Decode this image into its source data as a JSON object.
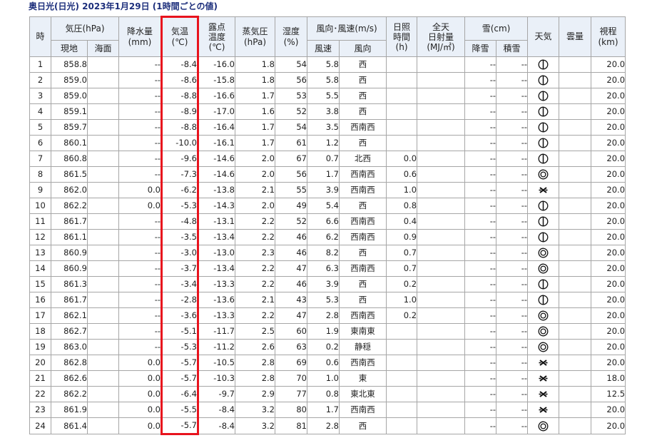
{
  "title": "奥日光(日光)  2023年1月29日  (1時間ごとの値)",
  "header": {
    "hour": "時",
    "pressure": "気圧(hPa)",
    "pressure_station": "現地",
    "pressure_sea": "海面",
    "precip": "降水量\n(mm)",
    "temp": "気温\n(℃)",
    "dew": "露点\n温度\n(℃)",
    "vapor": "蒸気圧\n(hPa)",
    "humidity": "湿度\n(%)",
    "wind": "風向･風速(m/s)",
    "wind_speed": "風速",
    "wind_dir": "風向",
    "sunshine": "日照\n時間\n(h)",
    "radiation": "全天\n日射量\n(MJ/㎡)",
    "snow": "雪(cm)",
    "snowfall": "降雪",
    "snowdepth": "積雪",
    "weather": "天気",
    "cloud": "雲量",
    "visibility": "視程\n(km)"
  },
  "highlight_color": "#e8131d",
  "weather_icon_names": {
    "clear-ish": "partly-cloudy-icon",
    "cloudy": "cloudy-icon",
    "snow": "snow-icon"
  },
  "rows": [
    {
      "hour": "1",
      "p": "858.8",
      "sea": "",
      "precip": "--",
      "temp": "-8.4",
      "dew": "-16.0",
      "vap": "1.8",
      "hum": "54",
      "ws": "5.8",
      "wd": "西",
      "sun": "",
      "rad": "",
      "snowfall": "--",
      "snowdepth": "--",
      "wx": "partly",
      "cloud": "",
      "vis": "20.0"
    },
    {
      "hour": "2",
      "p": "859.0",
      "sea": "",
      "precip": "--",
      "temp": "-8.6",
      "dew": "-15.8",
      "vap": "1.8",
      "hum": "56",
      "ws": "5.8",
      "wd": "西",
      "sun": "",
      "rad": "",
      "snowfall": "--",
      "snowdepth": "--",
      "wx": "partly",
      "cloud": "",
      "vis": "20.0"
    },
    {
      "hour": "3",
      "p": "859.0",
      "sea": "",
      "precip": "--",
      "temp": "-8.8",
      "dew": "-16.6",
      "vap": "1.7",
      "hum": "53",
      "ws": "5.5",
      "wd": "西",
      "sun": "",
      "rad": "",
      "snowfall": "--",
      "snowdepth": "--",
      "wx": "partly",
      "cloud": "",
      "vis": "20.0"
    },
    {
      "hour": "4",
      "p": "859.1",
      "sea": "",
      "precip": "--",
      "temp": "-8.9",
      "dew": "-17.0",
      "vap": "1.6",
      "hum": "52",
      "ws": "3.8",
      "wd": "西",
      "sun": "",
      "rad": "",
      "snowfall": "--",
      "snowdepth": "--",
      "wx": "partly",
      "cloud": "",
      "vis": "20.0"
    },
    {
      "hour": "5",
      "p": "859.7",
      "sea": "",
      "precip": "--",
      "temp": "-8.8",
      "dew": "-16.4",
      "vap": "1.7",
      "hum": "54",
      "ws": "3.5",
      "wd": "西南西",
      "sun": "",
      "rad": "",
      "snowfall": "--",
      "snowdepth": "--",
      "wx": "partly",
      "cloud": "",
      "vis": "20.0"
    },
    {
      "hour": "6",
      "p": "860.1",
      "sea": "",
      "precip": "--",
      "temp": "-10.0",
      "dew": "-16.1",
      "vap": "1.7",
      "hum": "61",
      "ws": "1.2",
      "wd": "西",
      "sun": "",
      "rad": "",
      "snowfall": "--",
      "snowdepth": "--",
      "wx": "partly",
      "cloud": "",
      "vis": "20.0"
    },
    {
      "hour": "7",
      "p": "860.8",
      "sea": "",
      "precip": "--",
      "temp": "-9.6",
      "dew": "-14.6",
      "vap": "2.0",
      "hum": "67",
      "ws": "0.7",
      "wd": "北西",
      "sun": "0.0",
      "rad": "",
      "snowfall": "--",
      "snowdepth": "--",
      "wx": "partly",
      "cloud": "",
      "vis": "20.0"
    },
    {
      "hour": "8",
      "p": "861.5",
      "sea": "",
      "precip": "--",
      "temp": "-7.3",
      "dew": "-14.6",
      "vap": "2.0",
      "hum": "56",
      "ws": "1.7",
      "wd": "西南西",
      "sun": "0.6",
      "rad": "",
      "snowfall": "--",
      "snowdepth": "--",
      "wx": "cloudy",
      "cloud": "",
      "vis": "20.0"
    },
    {
      "hour": "9",
      "p": "862.0",
      "sea": "",
      "precip": "0.0",
      "temp": "-6.2",
      "dew": "-13.8",
      "vap": "2.1",
      "hum": "55",
      "ws": "3.9",
      "wd": "西南西",
      "sun": "1.0",
      "rad": "",
      "snowfall": "--",
      "snowdepth": "--",
      "wx": "snow",
      "cloud": "",
      "vis": "20.0"
    },
    {
      "hour": "10",
      "p": "862.2",
      "sea": "",
      "precip": "0.0",
      "temp": "-5.3",
      "dew": "-14.3",
      "vap": "2.0",
      "hum": "49",
      "ws": "5.4",
      "wd": "西",
      "sun": "0.8",
      "rad": "",
      "snowfall": "--",
      "snowdepth": "--",
      "wx": "partly",
      "cloud": "",
      "vis": "20.0"
    },
    {
      "hour": "11",
      "p": "861.7",
      "sea": "",
      "precip": "--",
      "temp": "-4.8",
      "dew": "-13.1",
      "vap": "2.2",
      "hum": "52",
      "ws": "6.6",
      "wd": "西南西",
      "sun": "0.4",
      "rad": "",
      "snowfall": "--",
      "snowdepth": "--",
      "wx": "partly",
      "cloud": "",
      "vis": "20.0"
    },
    {
      "hour": "12",
      "p": "861.1",
      "sea": "",
      "precip": "--",
      "temp": "-3.5",
      "dew": "-13.4",
      "vap": "2.2",
      "hum": "46",
      "ws": "6.2",
      "wd": "西南西",
      "sun": "0.9",
      "rad": "",
      "snowfall": "--",
      "snowdepth": "--",
      "wx": "partly",
      "cloud": "",
      "vis": "20.0"
    },
    {
      "hour": "13",
      "p": "860.9",
      "sea": "",
      "precip": "--",
      "temp": "-3.0",
      "dew": "-13.0",
      "vap": "2.3",
      "hum": "46",
      "ws": "8.2",
      "wd": "西",
      "sun": "0.7",
      "rad": "",
      "snowfall": "--",
      "snowdepth": "--",
      "wx": "cloudy",
      "cloud": "",
      "vis": "20.0"
    },
    {
      "hour": "14",
      "p": "860.9",
      "sea": "",
      "precip": "--",
      "temp": "-3.7",
      "dew": "-13.4",
      "vap": "2.2",
      "hum": "47",
      "ws": "6.3",
      "wd": "西南西",
      "sun": "0.7",
      "rad": "",
      "snowfall": "--",
      "snowdepth": "--",
      "wx": "cloudy",
      "cloud": "",
      "vis": "20.0"
    },
    {
      "hour": "15",
      "p": "861.3",
      "sea": "",
      "precip": "--",
      "temp": "-3.4",
      "dew": "-13.3",
      "vap": "2.2",
      "hum": "46",
      "ws": "3.9",
      "wd": "西",
      "sun": "0.2",
      "rad": "",
      "snowfall": "--",
      "snowdepth": "--",
      "wx": "partly",
      "cloud": "",
      "vis": "20.0"
    },
    {
      "hour": "16",
      "p": "861.7",
      "sea": "",
      "precip": "--",
      "temp": "-2.8",
      "dew": "-13.6",
      "vap": "2.1",
      "hum": "43",
      "ws": "5.3",
      "wd": "西",
      "sun": "1.0",
      "rad": "",
      "snowfall": "--",
      "snowdepth": "--",
      "wx": "partly",
      "cloud": "",
      "vis": "20.0"
    },
    {
      "hour": "17",
      "p": "862.1",
      "sea": "",
      "precip": "--",
      "temp": "-3.6",
      "dew": "-13.3",
      "vap": "2.2",
      "hum": "47",
      "ws": "2.8",
      "wd": "西南西",
      "sun": "0.2",
      "rad": "",
      "snowfall": "--",
      "snowdepth": "--",
      "wx": "cloudy",
      "cloud": "",
      "vis": "20.0"
    },
    {
      "hour": "18",
      "p": "862.7",
      "sea": "",
      "precip": "--",
      "temp": "-5.1",
      "dew": "-11.7",
      "vap": "2.5",
      "hum": "60",
      "ws": "1.9",
      "wd": "東南東",
      "sun": "",
      "rad": "",
      "snowfall": "--",
      "snowdepth": "--",
      "wx": "cloudy",
      "cloud": "",
      "vis": "20.0"
    },
    {
      "hour": "19",
      "p": "863.0",
      "sea": "",
      "precip": "--",
      "temp": "-5.3",
      "dew": "-11.2",
      "vap": "2.6",
      "hum": "63",
      "ws": "0.2",
      "wd": "静穏",
      "sun": "",
      "rad": "",
      "snowfall": "--",
      "snowdepth": "--",
      "wx": "cloudy",
      "cloud": "",
      "vis": "20.0"
    },
    {
      "hour": "20",
      "p": "862.8",
      "sea": "",
      "precip": "0.0",
      "temp": "-5.7",
      "dew": "-10.5",
      "vap": "2.8",
      "hum": "69",
      "ws": "0.6",
      "wd": "西南西",
      "sun": "",
      "rad": "",
      "snowfall": "--",
      "snowdepth": "--",
      "wx": "snow",
      "cloud": "",
      "vis": "20.0"
    },
    {
      "hour": "21",
      "p": "862.6",
      "sea": "",
      "precip": "0.0",
      "temp": "-5.7",
      "dew": "-10.3",
      "vap": "2.8",
      "hum": "70",
      "ws": "1.0",
      "wd": "東",
      "sun": "",
      "rad": "",
      "snowfall": "--",
      "snowdepth": "--",
      "wx": "snow",
      "cloud": "",
      "vis": "18.0"
    },
    {
      "hour": "22",
      "p": "862.2",
      "sea": "",
      "precip": "0.0",
      "temp": "-6.4",
      "dew": "-9.7",
      "vap": "2.9",
      "hum": "77",
      "ws": "0.8",
      "wd": "東北東",
      "sun": "",
      "rad": "",
      "snowfall": "--",
      "snowdepth": "--",
      "wx": "snow",
      "cloud": "",
      "vis": "12.5"
    },
    {
      "hour": "23",
      "p": "861.9",
      "sea": "",
      "precip": "0.0",
      "temp": "-5.5",
      "dew": "-8.4",
      "vap": "3.2",
      "hum": "80",
      "ws": "1.7",
      "wd": "西南西",
      "sun": "",
      "rad": "",
      "snowfall": "--",
      "snowdepth": "--",
      "wx": "snow",
      "cloud": "",
      "vis": "20.0"
    },
    {
      "hour": "24",
      "p": "861.4",
      "sea": "",
      "precip": "0.0",
      "temp": "-5.7",
      "dew": "-8.4",
      "vap": "3.2",
      "hum": "81",
      "ws": "2.8",
      "wd": "西",
      "sun": "",
      "rad": "",
      "snowfall": "--",
      "snowdepth": "--",
      "wx": "cloudy",
      "cloud": "",
      "vis": "20.0"
    }
  ]
}
